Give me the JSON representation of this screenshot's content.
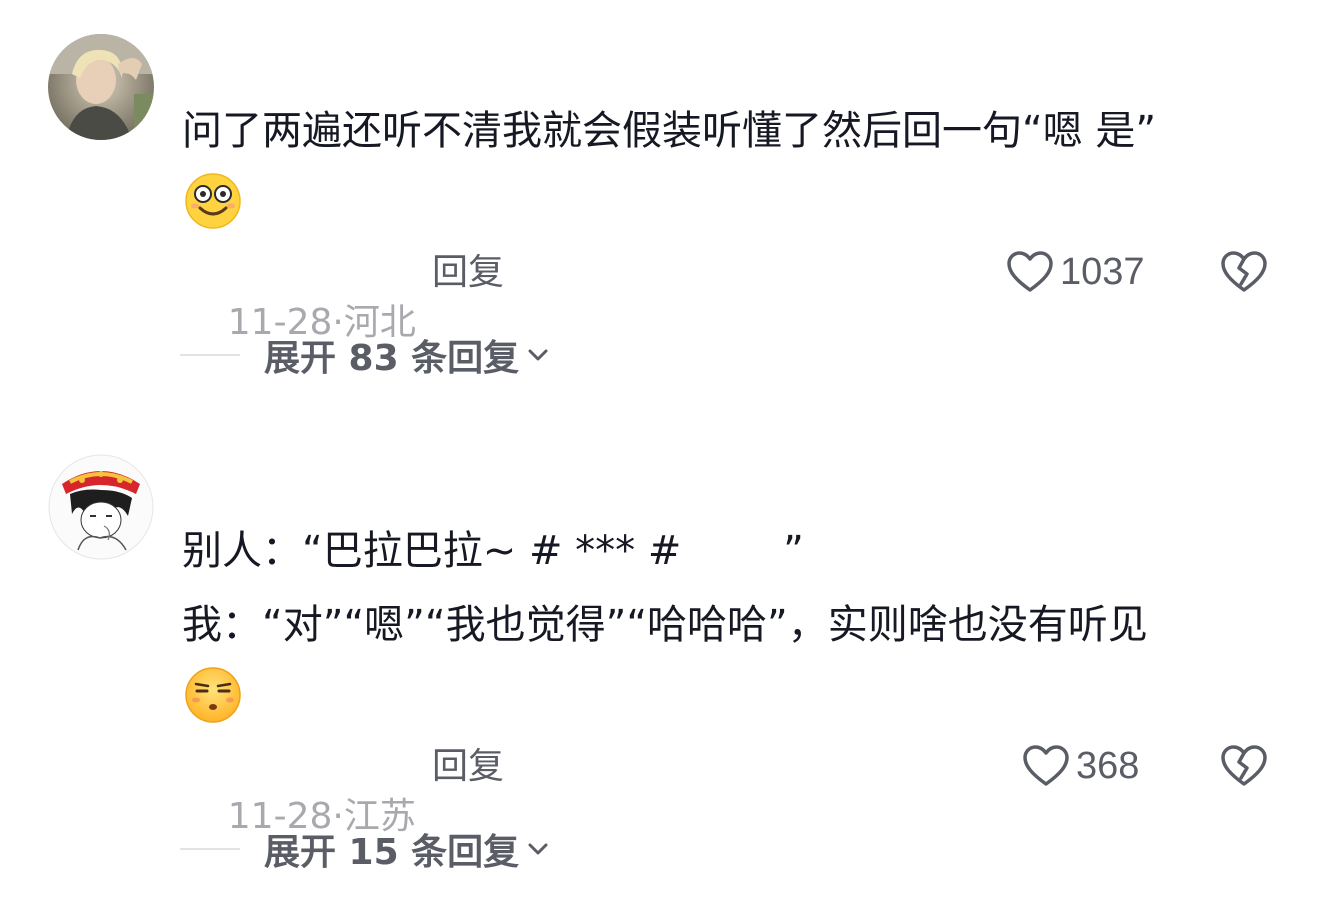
{
  "comments": [
    {
      "avatar_icon": "user-avatar-photo",
      "lines": [
        "问了两遍还听不清我就会假装听懂了然后回一句“嗯 是”"
      ],
      "emoji_icon": "dizzy-smile-emoji",
      "date": "11-28",
      "separator": "·",
      "location": "河北",
      "reply_label": "回复",
      "likes": "1037",
      "expand_label": "展开 83 条回复"
    },
    {
      "avatar_icon": "anime-avatar-illustration",
      "lines": [
        "别人：“巴拉巴拉~ # *** #        ”",
        "我：“对”“嗯”“我也觉得”“哈哈哈”，实则啥也没有听见"
      ],
      "emoji_icon": "smirk-emoji",
      "date": "11-28",
      "separator": "·",
      "location": "江苏",
      "reply_label": "回复",
      "likes": "368",
      "expand_label": "展开 15 条回复"
    }
  ],
  "colors": {
    "text_primary": "#161823",
    "text_meta": "#a8a9ae",
    "text_action": "#5b5d66",
    "emoji_yellow": "#ffd23f"
  }
}
